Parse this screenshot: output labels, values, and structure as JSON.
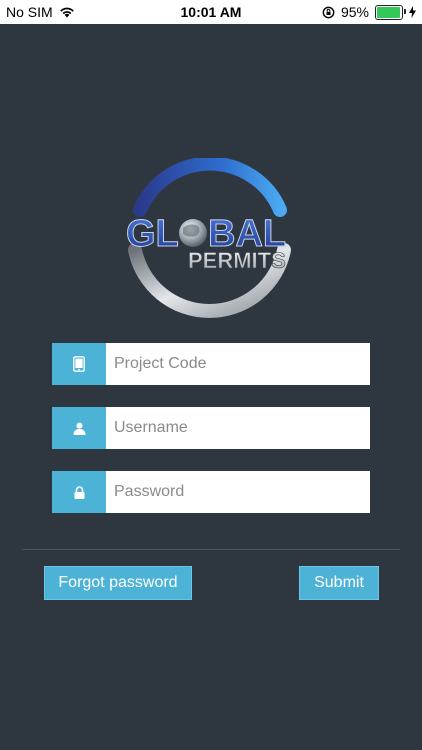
{
  "status_bar": {
    "carrier": "No SIM",
    "time": "10:01 AM",
    "battery_percent": "95%",
    "battery_level": 0.95,
    "icons": [
      "wifi-icon",
      "orientation-lock-icon",
      "battery-icon",
      "charging-bolt-icon"
    ]
  },
  "logo": {
    "text_line1": "GL",
    "text_line1b": "BAL",
    "text_line2": "PERMITS"
  },
  "form": {
    "project_code_placeholder": "Project Code",
    "username_placeholder": "Username",
    "password_placeholder": "Password",
    "icons": [
      "tablet-icon",
      "user-icon",
      "lock-icon"
    ]
  },
  "actions": {
    "forgot_label": "Forgot password",
    "submit_label": "Submit"
  },
  "colors": {
    "background": "#2e3640",
    "accent": "#4db3d6",
    "status_bar": "#ffffff",
    "battery": "#34c759"
  }
}
